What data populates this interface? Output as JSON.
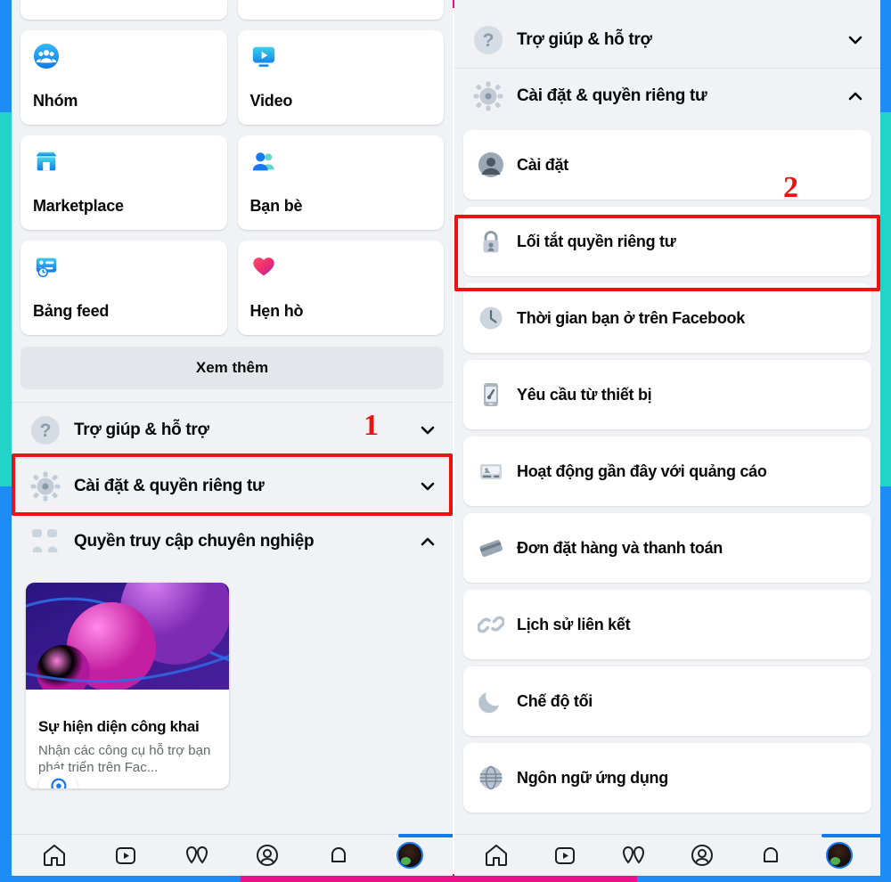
{
  "frame_colors": {
    "blue": "#1d8df5",
    "teal": "#22d3c8",
    "pink": "#ec0f8c",
    "annotation_red": "#ee1111",
    "facebook_blue": "#1877f2",
    "panel_bg": "#f0f2f5"
  },
  "left_panel": {
    "shortcut_tiles": [
      {
        "label": "Nhóm",
        "icon": "groups-icon"
      },
      {
        "label": "Video",
        "icon": "video-icon"
      },
      {
        "label": "Marketplace",
        "icon": "marketplace-icon"
      },
      {
        "label": "Bạn bè",
        "icon": "friends-icon"
      },
      {
        "label": "Bảng feed",
        "icon": "feeds-icon"
      },
      {
        "label": "Hẹn hò",
        "icon": "dating-heart-icon"
      }
    ],
    "see_more_label": "Xem thêm",
    "accordions": [
      {
        "label": "Trợ giúp & hỗ trợ",
        "icon": "question-mark-icon",
        "state": "collapsed",
        "chevron": "chevron-down-icon"
      },
      {
        "label": "Cài đặt & quyền riêng tư",
        "icon": "gear-icon",
        "state": "collapsed",
        "chevron": "chevron-down-icon"
      },
      {
        "label": "Quyền truy cập chuyên nghiệp",
        "icon": "professional-access-icon",
        "state": "expanded",
        "chevron": "chevron-up-icon"
      }
    ],
    "promo_card": {
      "icon": "public-presence-icon",
      "title": "Sự hiện diện công khai",
      "description": "Nhận các công cụ hỗ trợ bạn phát triển trên Fac..."
    }
  },
  "right_panel": {
    "accordions": [
      {
        "label": "Trợ giúp & hỗ trợ",
        "icon": "question-mark-icon",
        "state": "collapsed",
        "chevron": "chevron-down-icon"
      },
      {
        "label": "Cài đặt & quyền riêng tư",
        "icon": "gear-icon",
        "state": "expanded",
        "chevron": "chevron-up-icon"
      }
    ],
    "settings_items": [
      {
        "label": "Cài đặt",
        "icon": "account-circle-icon"
      },
      {
        "label": "Lối tắt quyền riêng tư",
        "icon": "privacy-lock-icon"
      },
      {
        "label": "Thời gian bạn ở trên Facebook",
        "icon": "clock-icon"
      },
      {
        "label": "Yêu cầu từ thiết bị",
        "icon": "device-request-icon"
      },
      {
        "label": "Hoạt động gần đây với quảng cáo",
        "icon": "ad-activity-icon"
      },
      {
        "label": "Đơn đặt hàng và thanh toán",
        "icon": "payments-card-icon"
      },
      {
        "label": "Lịch sử liên kết",
        "icon": "link-history-icon"
      },
      {
        "label": "Chế độ tối",
        "icon": "moon-icon"
      },
      {
        "label": "Ngôn ngữ ứng dụng",
        "icon": "globe-icon"
      }
    ]
  },
  "bottom_nav": {
    "items": [
      {
        "icon": "home-icon"
      },
      {
        "icon": "video-play-icon"
      },
      {
        "icon": "marketplace-heart-icon"
      },
      {
        "icon": "profile-circle-icon"
      },
      {
        "icon": "notifications-bell-icon"
      },
      {
        "icon": "user-avatar"
      }
    ]
  },
  "annotations": {
    "markers": [
      {
        "number": "1",
        "target": "left-panel Cài đặt & quyền riêng tư row"
      },
      {
        "number": "2",
        "target": "right-panel Lối tắt quyền riêng tư row"
      }
    ]
  }
}
